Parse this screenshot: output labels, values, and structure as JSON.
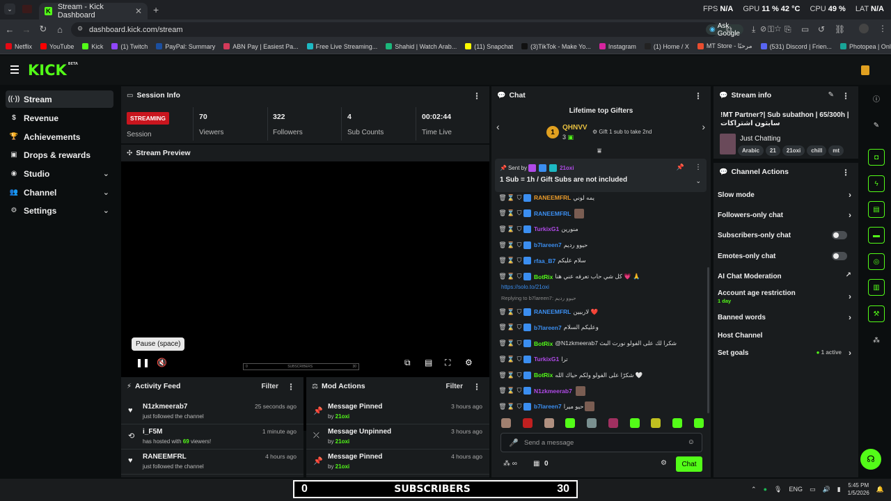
{
  "browser": {
    "tab_title": "Stream - Kick Dashboard",
    "tab_favicon": "K",
    "url": "dashboard.kick.com/stream",
    "ask_google": "Ask Google",
    "hw": {
      "fps_label": "FPS",
      "fps_value": "N/A",
      "gpu_label": "GPU",
      "gpu_value": "11 % 42 °C",
      "cpu_label": "CPU",
      "cpu_value": "49 %",
      "lat_label": "LAT",
      "lat_value": "N/A"
    },
    "bookmarks": [
      {
        "label": "Netflix",
        "color": "#e50914"
      },
      {
        "label": "YouTube",
        "color": "#ff0000"
      },
      {
        "label": "Kick",
        "color": "#53fc18"
      },
      {
        "label": "(1) Twitch",
        "color": "#9146ff"
      },
      {
        "label": "PayPal: Summary",
        "color": "#1b4fa0"
      },
      {
        "label": "ABN Pay | Easiest Pa...",
        "color": "#d43a5a"
      },
      {
        "label": "Free Live Streaming...",
        "color": "#1db9c3"
      },
      {
        "label": "Shahid | Watch Arab...",
        "color": "#1bb87b"
      },
      {
        "label": "(11) Snapchat",
        "color": "#fffc00"
      },
      {
        "label": "(3)TikTok - Make Yo...",
        "color": "#111111"
      },
      {
        "label": "Instagram",
        "color": "#d6249f"
      },
      {
        "label": "(1) Home / X",
        "color": "#222222"
      },
      {
        "label": "MT Store - مرحبًا",
        "color": "#e94d2f"
      },
      {
        "label": "(531) Discord | Frien...",
        "color": "#5865f2"
      },
      {
        "label": "Photopea | Online P...",
        "color": "#18a497"
      }
    ]
  },
  "nav": {
    "logo": "KICK",
    "logo_sup": "BETA",
    "items": [
      {
        "label": "Stream",
        "icon": "signal-icon",
        "glyph": "((·))"
      },
      {
        "label": "Revenue",
        "icon": "dollar-icon",
        "glyph": "$"
      },
      {
        "label": "Achievements",
        "icon": "trophy-icon",
        "glyph": "🏆"
      },
      {
        "label": "Drops & rewards",
        "icon": "gift-icon",
        "glyph": "▣"
      },
      {
        "label": "Studio",
        "icon": "palette-icon",
        "glyph": "◉"
      },
      {
        "label": "Channel",
        "icon": "users-icon",
        "glyph": "👥"
      },
      {
        "label": "Settings",
        "icon": "gear-icon",
        "glyph": "⚙"
      }
    ]
  },
  "session": {
    "title": "Session Info",
    "status": "STREAMING",
    "status_label": "Session",
    "stats": [
      {
        "value": "70",
        "label": "Viewers"
      },
      {
        "value": "322",
        "label": "Followers"
      },
      {
        "value": "4",
        "label": "Sub Counts"
      },
      {
        "value": "00:02:44",
        "label": "Time Live"
      }
    ]
  },
  "preview": {
    "title": "Stream Preview",
    "tooltip": "Pause (space)",
    "overlay_left": "0",
    "overlay_mid": "SUBSCRIBERS",
    "overlay_right": "30"
  },
  "activity": {
    "title": "Activity Feed",
    "filter": "Filter",
    "rows": [
      {
        "name": "N1zkmeerab7",
        "pre": "just followed the channel",
        "count": "",
        "post": "",
        "time": "25 seconds ago",
        "icon": "heart-icon",
        "glyph": "♥"
      },
      {
        "name": "i_F5M",
        "pre": "has hosted with ",
        "count": "69",
        "post": " viewers!",
        "time": "1 minute ago",
        "icon": "host-icon",
        "glyph": "⟲"
      },
      {
        "name": "RANEEMFRL",
        "pre": "just followed the channel",
        "count": "",
        "post": "",
        "time": "4 hours ago",
        "icon": "heart-icon",
        "glyph": "♥"
      }
    ]
  },
  "mod": {
    "title": "Mod Actions",
    "filter": "Filter",
    "rows": [
      {
        "name": "Message Pinned",
        "by_prefix": "by ",
        "by": "21oxi",
        "time": "3 hours ago",
        "icon": "pin-icon",
        "glyph": "📌"
      },
      {
        "name": "Message Unpinned",
        "by_prefix": "by ",
        "by": "21oxi",
        "time": "3 hours ago",
        "icon": "unpin-icon",
        "glyph": "⤫"
      },
      {
        "name": "Message Pinned",
        "by_prefix": "by ",
        "by": "21oxi",
        "time": "4 hours ago",
        "icon": "pin-icon",
        "glyph": "📌"
      }
    ]
  },
  "chat": {
    "title": "Chat",
    "gifters_title": "Lifetime top Gifters",
    "gifter_rank": "1",
    "gifter_name": "QHNVV",
    "gifter_count": "3",
    "gift_cta": "Gift 1 sub to take 2nd",
    "pinned_sent_by": "Sent by",
    "pinned_user": "21oxi",
    "pinned_text": "1 Sub = 1h / Gift Subs are not included",
    "reply_label": "Replying to b7lareen7: حيوو رديم",
    "link": "https://solo.to/21oxi",
    "messages": [
      {
        "user": "RANEEMFRL",
        "color": "#e89a2a",
        "text": "يمه لوني",
        "emote": false
      },
      {
        "user": "RANEEMFRL",
        "color": "#3b8ef0",
        "text": "",
        "emote": true
      },
      {
        "user": "TurkixG1",
        "color": "#b04ae8",
        "text": "منورين",
        "emote": false
      },
      {
        "user": "b7lareen7",
        "color": "#3b8ef0",
        "text": "حيوو رديم",
        "emote": false
      },
      {
        "user": "rfaa_B7",
        "color": "#3b8ef0",
        "text": "سلام عليكم",
        "emote": false
      },
      {
        "user": "BotRix",
        "color": "#53fc18",
        "text": "كل شي حاب تعرفه عني هنا 💗 🙏",
        "emote": false
      },
      {
        "user": "RANEEMFRL",
        "color": "#3b8ef0",
        "text": "لاربيين ❤️",
        "emote": false
      },
      {
        "user": "b7lareen7",
        "color": "#3b8ef0",
        "text": "وعليكم السلام",
        "emote": false
      },
      {
        "user": "BotRix",
        "color": "#53fc18",
        "text": "@N1zkmeerab7 شكرا لك على الفولو نورت البث",
        "emote": false
      },
      {
        "user": "TurkixG1",
        "color": "#b04ae8",
        "text": "ترا",
        "emote": false
      },
      {
        "user": "BotRix",
        "color": "#53fc18",
        "text": "شكرًا على الفولو ولكم حياك الله 🤍",
        "emote": false
      },
      {
        "user": "N1zkmeerab7",
        "color": "#b04ae8",
        "text": "",
        "emote": true
      },
      {
        "user": "b7lareen7",
        "color": "#3b8ef0",
        "text": "حيو ميرا",
        "emote": true
      }
    ],
    "placeholder": "Send a message",
    "points": "0",
    "chat_button": "Chat"
  },
  "stream_info": {
    "title": "Stream info",
    "stream_title": "!MT Partner?| Sub subathon | 65/300h | سابثون اشتراكات",
    "category": "Just Chatting",
    "tags": [
      "Arabic",
      "21",
      "21oxi",
      "chill",
      "mt"
    ]
  },
  "channel_actions": {
    "title": "Channel Actions",
    "rows": [
      {
        "label": "Slow mode",
        "type": "arrow"
      },
      {
        "label": "Followers-only chat",
        "type": "arrow"
      },
      {
        "label": "Subscribers-only chat",
        "type": "toggle",
        "state": "off"
      },
      {
        "label": "Emotes-only chat",
        "type": "toggle",
        "state": "off"
      },
      {
        "label": "AI Chat Moderation",
        "type": "external"
      },
      {
        "label": "Account age restriction",
        "sub": "1 day",
        "type": "arrow"
      },
      {
        "label": "Banned words",
        "type": "arrow"
      },
      {
        "label": "Host Channel",
        "type": "none"
      },
      {
        "label": "Set goals",
        "sub_right": "1 active",
        "type": "arrow"
      }
    ]
  },
  "taskbar": {
    "sub_left": "0",
    "sub_mid": "SUBSCRIBERS",
    "sub_right": "30",
    "lang": "ENG",
    "time": "5:45 PM",
    "date": "1/5/2026"
  },
  "colors": {
    "kick_green": "#53fc18",
    "streaming_red": "#c9151e",
    "panel": "#191c1e"
  }
}
